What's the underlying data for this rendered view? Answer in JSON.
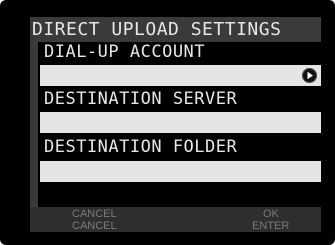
{
  "dialog": {
    "title": "DIRECT UPLOAD SETTINGS"
  },
  "fields": [
    {
      "label": "DIAL-UP ACCOUNT",
      "value": "",
      "has_arrow": true,
      "arrow_icon": "play-arrow-icon"
    },
    {
      "label": "DESTINATION SERVER",
      "value": ""
    },
    {
      "label": "DESTINATION FOLDER",
      "value": ""
    }
  ],
  "footer": {
    "left": {
      "action": "CANCEL",
      "key": "CANCEL"
    },
    "right": {
      "action": "OK",
      "key": "ENTER"
    }
  },
  "colors": {
    "background": "#000000",
    "panel": "#3a3a3a",
    "text": "#e6e6e6",
    "field": "#e4e4e4",
    "footer_text": "#7a7a7a"
  }
}
